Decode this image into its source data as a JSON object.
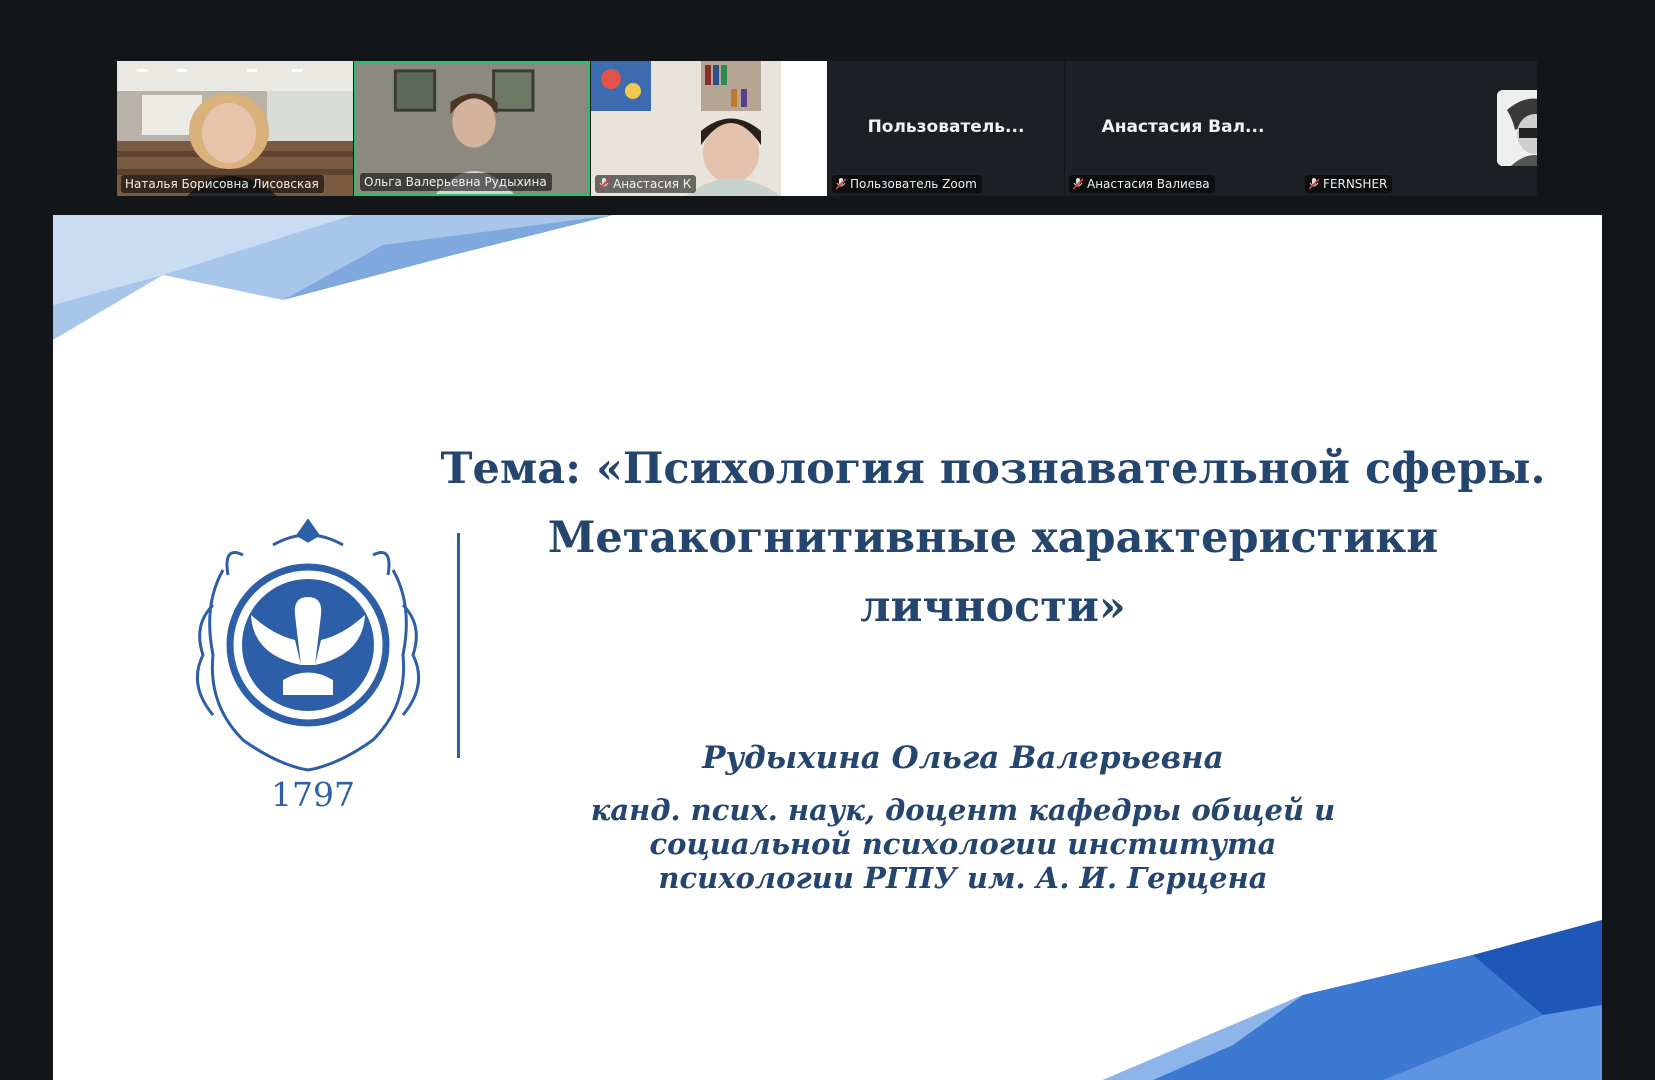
{
  "meeting": {
    "participants": [
      {
        "name": "Наталья Борисовна Лисовская",
        "muted": false,
        "video": true
      },
      {
        "name": "Ольга Валерьевна Рудыхина",
        "muted": false,
        "video": true,
        "speaking": true
      },
      {
        "name": "Анастасия К",
        "muted": true,
        "video": true
      },
      {
        "name": "Пользователь Zoom",
        "display_name": "Пользователь...",
        "muted": true,
        "video": false
      },
      {
        "name": "Анастасия Валиева",
        "display_name": "Анастасия  Вал...",
        "muted": true,
        "video": false
      },
      {
        "name": "FERNSHER",
        "muted": true,
        "video": false,
        "avatar": true
      }
    ],
    "colors": {
      "speaking_border": "#25c46a",
      "background": "#121619"
    }
  },
  "slide": {
    "title_lines": [
      "Тема: «Психология познавательной сферы.",
      "Метакогнитивные характеристики",
      "личности»"
    ],
    "year": "1797",
    "author": "Рудыхина Ольга Валерьевна",
    "affiliation_lines": [
      "канд. псих. наук, доцент кафедры общей и",
      "социальной психологии института",
      "психологии РГПУ им. А. И. Герцена"
    ],
    "colors": {
      "text": "#24456e",
      "accent": "#2d5fa8"
    },
    "emblem": "pelican-coat-of-arms-icon"
  }
}
